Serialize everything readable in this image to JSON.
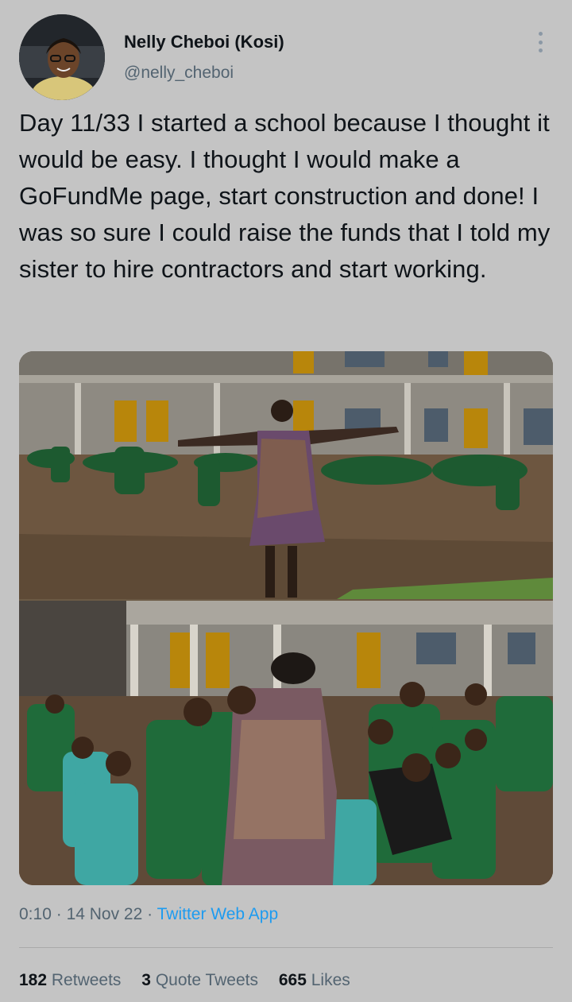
{
  "author": {
    "display_name": "Nelly Cheboi (Kosi)",
    "handle": "@nelly_cheboi",
    "avatar_icon": "profile-photo-icon"
  },
  "more_icon": "more-options-icon",
  "tweet_text": "Day 11/33 I started a school because I thought it would be easy. I thought I would make a GoFundMe page, start construction and done! I was so sure I could raise the funds that I told my sister to hire contractors and start working.",
  "media": {
    "description_icon": "photo-icon",
    "panels": 2
  },
  "meta": {
    "time": "0:10",
    "date": "14 Nov 22",
    "separator": "·",
    "source": "Twitter Web App"
  },
  "stats": {
    "retweets_count": "182",
    "retweets_label": "Retweets",
    "quotes_count": "3",
    "quotes_label": "Quote Tweets",
    "likes_count": "665",
    "likes_label": "Likes"
  },
  "colors": {
    "background": "#c4c4c4",
    "text": "#0f1419",
    "secondary": "#536471",
    "link": "#1d9bf0"
  }
}
